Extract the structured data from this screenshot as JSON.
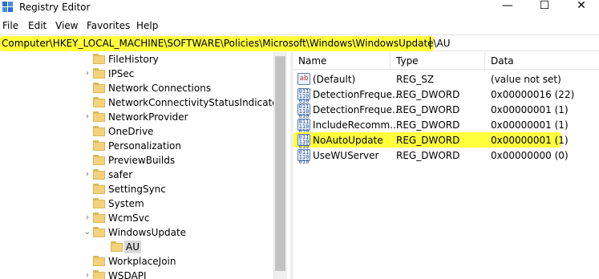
{
  "window": {
    "title": "Registry Editor",
    "controls": {
      "minimize": "—",
      "maximize": "☐",
      "close": "✕"
    }
  },
  "menu": [
    "File",
    "Edit",
    "View",
    "Favorites",
    "Help"
  ],
  "address": {
    "path": "Computer\\HKEY_LOCAL_MACHINE\\SOFTWARE\\Policies\\Microsoft\\Windows\\WindowsUpdate\\AU",
    "highlight_color": "#ffff3c"
  },
  "tree": {
    "items": [
      {
        "label": "FileHistory",
        "expander": ""
      },
      {
        "label": "IPSec",
        "expander": "›"
      },
      {
        "label": "Network Connections",
        "expander": ""
      },
      {
        "label": "NetworkConnectivityStatusIndicator",
        "expander": ""
      },
      {
        "label": "NetworkProvider",
        "expander": "›"
      },
      {
        "label": "OneDrive",
        "expander": ""
      },
      {
        "label": "Personalization",
        "expander": ""
      },
      {
        "label": "PreviewBuilds",
        "expander": ""
      },
      {
        "label": "safer",
        "expander": "›"
      },
      {
        "label": "SettingSync",
        "expander": ""
      },
      {
        "label": "System",
        "expander": ""
      },
      {
        "label": "WcmSvc",
        "expander": "›"
      },
      {
        "label": "WindowsUpdate",
        "expander": "⌄"
      },
      {
        "label": "AU",
        "expander": "",
        "selected": true
      },
      {
        "label": "WorkplaceJoin",
        "expander": ""
      },
      {
        "label": "WSDAPI",
        "expander": "›"
      }
    ]
  },
  "values": {
    "columns": [
      "Name",
      "Type",
      "Data"
    ],
    "rows": [
      {
        "name": "(Default)",
        "type": "REG_SZ",
        "data": "(value not set)",
        "icon": "ab"
      },
      {
        "name": "DetectionFreque...",
        "type": "REG_DWORD",
        "data": "0x00000016 (22)",
        "icon": "dword"
      },
      {
        "name": "DetectionFreque...",
        "type": "REG_DWORD",
        "data": "0x00000001 (1)",
        "icon": "dword"
      },
      {
        "name": "IncludeRecomm...",
        "type": "REG_DWORD",
        "data": "0x00000001 (1)",
        "icon": "dword"
      },
      {
        "name": "NoAutoUpdate",
        "type": "REG_DWORD",
        "data": "0x00000001 (1)",
        "icon": "dword",
        "highlighted": true
      },
      {
        "name": "UseWUServer",
        "type": "REG_DWORD",
        "data": "0x00000000 (0)",
        "icon": "dword"
      }
    ]
  }
}
